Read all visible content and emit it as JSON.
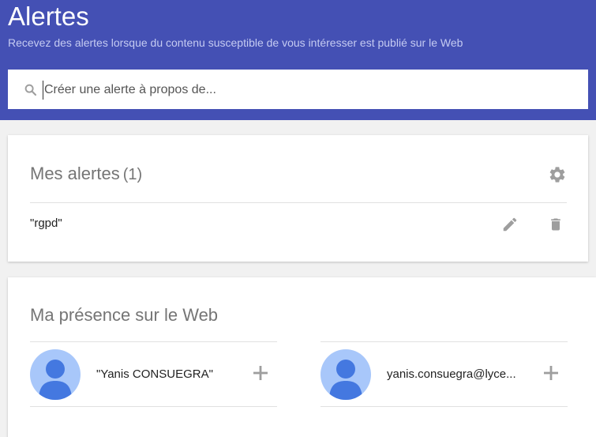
{
  "header": {
    "title": "Alertes",
    "subtitle": "Recevez des alertes lorsque du contenu susceptible de vous intéresser est publié sur le Web"
  },
  "search": {
    "placeholder": "Créer une alerte à propos de...",
    "icon": "search-icon"
  },
  "alerts": {
    "title": "Mes alertes",
    "count": "(1)",
    "settings_icon": "gear-icon",
    "items": [
      {
        "query": "\"rgpd\"",
        "edit_icon": "edit-icon",
        "delete_icon": "delete-icon"
      }
    ]
  },
  "presence": {
    "title": "Ma présence sur le Web",
    "items": [
      {
        "label": "\"Yanis CONSUEGRA\"",
        "icon": "plus-icon"
      },
      {
        "label": "yanis.consuegra@lyce...",
        "icon": "plus-icon"
      }
    ]
  },
  "colors": {
    "header_bg": "#4450b4",
    "avatar_bg": "#a8c7fa",
    "avatar_fg": "#4478e0",
    "icon_gray": "#9e9e9e"
  }
}
